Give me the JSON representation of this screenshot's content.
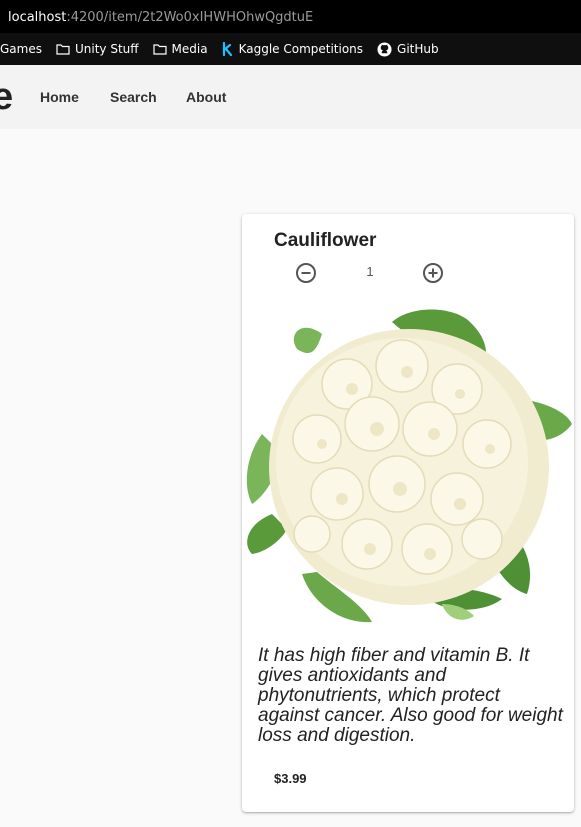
{
  "browser": {
    "url_host": "localhost",
    "url_path": ":4200/item/2t2Wo0xIHWHOhwQgdtuE",
    "bookmarks": [
      {
        "label": "Games",
        "icon": "none"
      },
      {
        "label": "Unity Stuff",
        "icon": "folder-icon"
      },
      {
        "label": "Media",
        "icon": "folder-icon"
      },
      {
        "label": "Kaggle Competitions",
        "icon": "kaggle-icon"
      },
      {
        "label": "GitHub",
        "icon": "github-icon"
      }
    ]
  },
  "nav": {
    "brand": "e",
    "links": [
      "Home",
      "Search",
      "About"
    ]
  },
  "item": {
    "name": "Cauliflower",
    "quantity": "1",
    "description": "It has high fiber and vitamin B. It gives antioxidants and phytonutrients, which protect against cancer. Also good for weight loss and digestion.",
    "price": "$3.99",
    "image": "cauliflower-image"
  },
  "colors": {
    "page_background": "#fafafa",
    "navbar_background": "#f3f3f3",
    "browser_chrome": "#000000",
    "kaggle_blue": "#20beff"
  }
}
